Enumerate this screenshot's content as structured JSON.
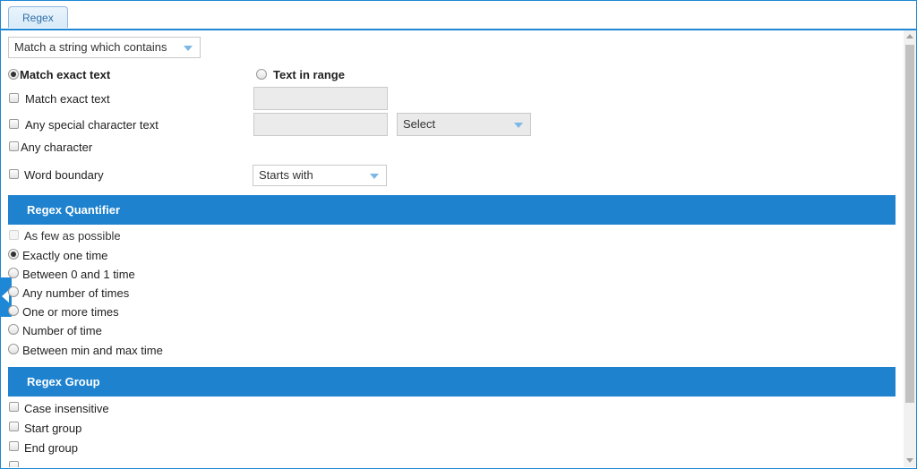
{
  "tabs": [
    {
      "label": "Regex"
    }
  ],
  "match_type_select": {
    "value": "Match a string which contains"
  },
  "radio_options": [
    {
      "label": "Match exact text",
      "selected": true
    },
    {
      "label": "Text in range",
      "selected": false
    }
  ],
  "text_options": {
    "match_exact_text": "Match exact text",
    "any_special_character_text": "Any special character text",
    "any_character": "Any character",
    "word_boundary": "Word boundary"
  },
  "special_char_select": {
    "value": "Select"
  },
  "word_boundary_select": {
    "value": "Starts with"
  },
  "quantifier": {
    "header": "Regex Quantifier",
    "as_few_as_possible": "As few as possible",
    "options": [
      {
        "label": "Exactly one time",
        "selected": true
      },
      {
        "label": "Between 0 and 1 time",
        "selected": false
      },
      {
        "label": "Any number of times",
        "selected": false
      },
      {
        "label": "One or more times",
        "selected": false
      },
      {
        "label": "Number of time",
        "selected": false
      },
      {
        "label": "Between min and max time",
        "selected": false
      }
    ]
  },
  "group": {
    "header": "Regex Group",
    "options": [
      {
        "label": "Case insensitive"
      },
      {
        "label": "Start group"
      },
      {
        "label": "End group"
      }
    ]
  },
  "colors": {
    "accent": "#1e82cf",
    "border": "#1e88d6"
  }
}
